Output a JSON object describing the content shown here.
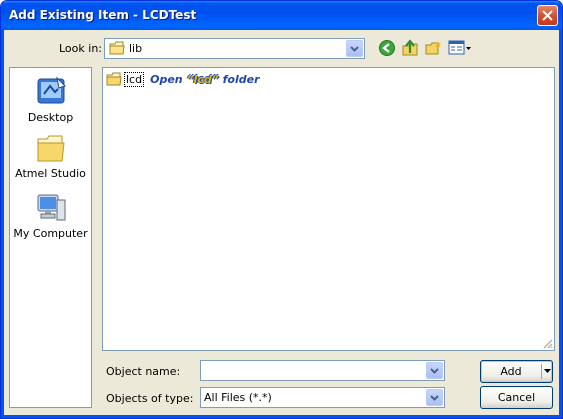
{
  "window": {
    "title": "Add Existing Item - LCDTest"
  },
  "lookin": {
    "label": "Look in:",
    "value": "lib"
  },
  "places": [
    {
      "label": "Desktop",
      "icon": "desktop-icon"
    },
    {
      "label": "Atmel Studio",
      "icon": "folder-icon"
    },
    {
      "label": "My Computer",
      "icon": "my-computer-icon"
    }
  ],
  "files": [
    {
      "name": "lcd",
      "icon": "folder-icon"
    }
  ],
  "annotation": {
    "prefix": "Open ",
    "highlight": "“lcd”",
    "suffix": " folder"
  },
  "object_name": {
    "label": "Object name:",
    "value": ""
  },
  "object_type": {
    "label": "Objects of type:",
    "value": "All Files (*.*)"
  },
  "buttons": {
    "add": "Add",
    "cancel": "Cancel"
  },
  "colors": {
    "titlebar": "#0054e3",
    "dialog_bg": "#ece9d8",
    "close": "#d8573a",
    "annotation": "#1e46aa"
  }
}
